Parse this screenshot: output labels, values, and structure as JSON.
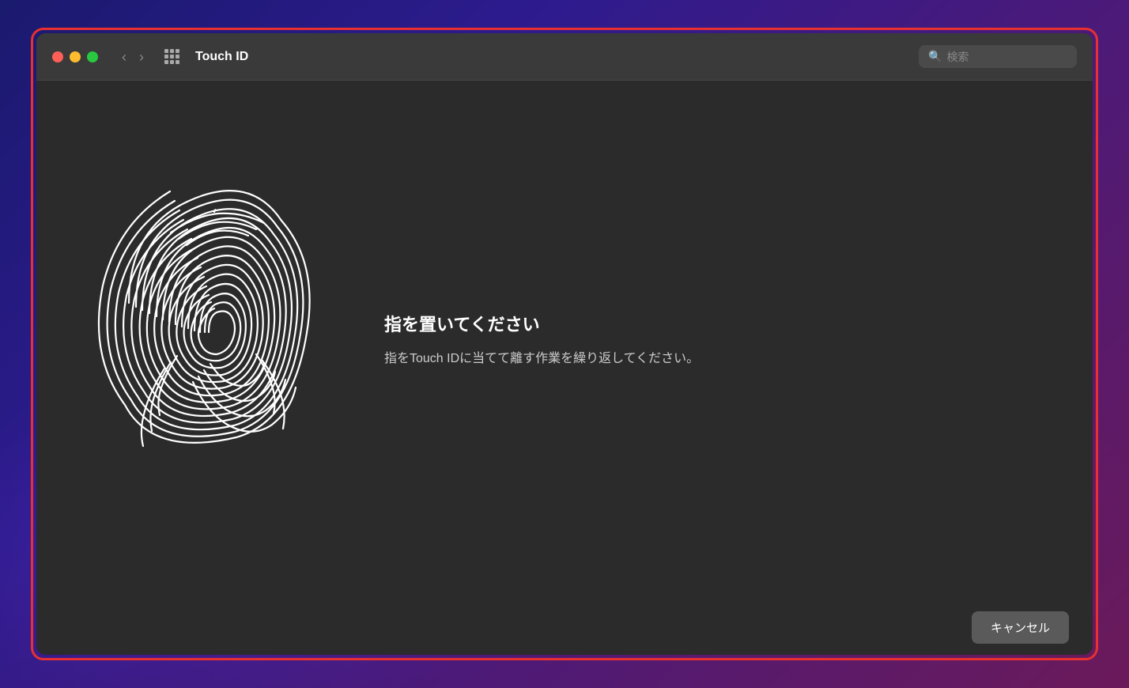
{
  "background": {
    "colors": [
      "#1a1a6e",
      "#2d1b8e",
      "#4a1a7a",
      "#6b1a5a"
    ]
  },
  "window": {
    "title": "Touch ID",
    "border_color": "#e83030"
  },
  "titlebar": {
    "traffic_lights": {
      "close_color": "#ff5f57",
      "minimize_color": "#febc2e",
      "maximize_color": "#28c840"
    },
    "back_label": "‹",
    "forward_label": "›",
    "title": "Touch ID",
    "search_placeholder": "検索"
  },
  "content": {
    "instruction_title": "指を置いてください",
    "instruction_body": "指をTouch IDに当てて離す作業を繰り返してください。"
  },
  "footer": {
    "cancel_label": "キャンセル"
  }
}
